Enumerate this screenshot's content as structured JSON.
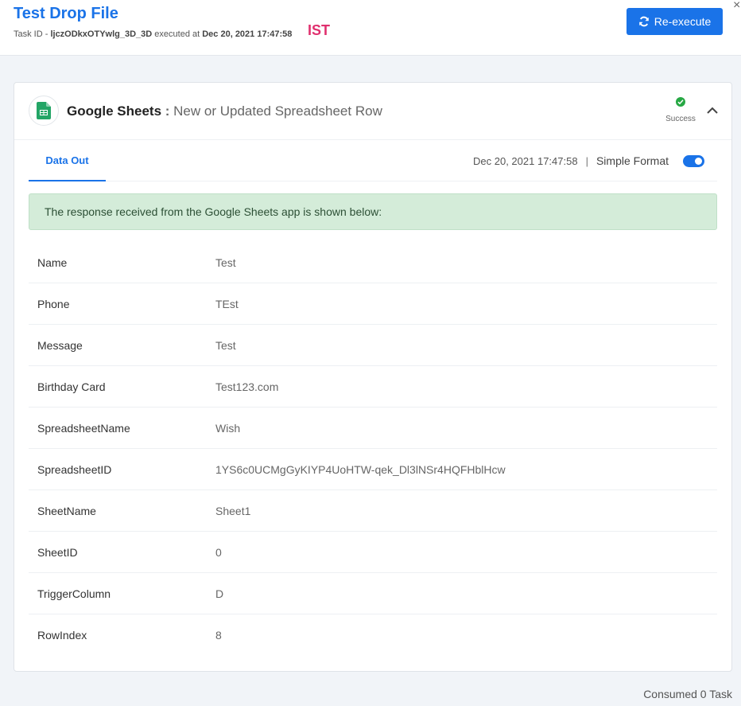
{
  "header": {
    "title": "Test Drop File",
    "task_id_label": "Task ID - ",
    "task_id": "ljczODkxOTYwlg_3D_3D",
    "executed_at_label": " executed at ",
    "executed_at": "Dec 20, 2021 17:47:58",
    "timezone_badge": "IST",
    "close_glyph": "×",
    "reexecute_label": "Re-execute"
  },
  "card": {
    "app_name": "Google Sheets",
    "app_separator": " : ",
    "trigger_name": "New or Updated Spreadsheet Row",
    "status": "Success",
    "status_color": "#27a844",
    "tab_label": "Data Out",
    "timestamp": "Dec 20, 2021 17:47:58",
    "pipe": "|",
    "format_label": "Simple Format",
    "format_toggle_on": true,
    "notice": "The response received from the Google Sheets app is shown below:",
    "rows": [
      {
        "key": "Name",
        "value": "Test"
      },
      {
        "key": "Phone",
        "value": "TEst"
      },
      {
        "key": "Message",
        "value": "Test"
      },
      {
        "key": "Birthday Card",
        "value": "Test123.com"
      },
      {
        "key": "SpreadsheetName",
        "value": "Wish"
      },
      {
        "key": "SpreadsheetID",
        "value": "1YS6c0UCMgGyKIYP4UoHTW-qek_Dl3lNSr4HQFHblHcw"
      },
      {
        "key": "SheetName",
        "value": "Sheet1"
      },
      {
        "key": "SheetID",
        "value": "0"
      },
      {
        "key": "TriggerColumn",
        "value": "D"
      },
      {
        "key": "RowIndex",
        "value": "8"
      }
    ]
  },
  "footer": {
    "consumed": "Consumed 0 Task"
  },
  "colors": {
    "accent": "#1a73e8",
    "success": "#27a844",
    "badge": "#e0306e",
    "notice_bg": "#d4ecd9"
  }
}
